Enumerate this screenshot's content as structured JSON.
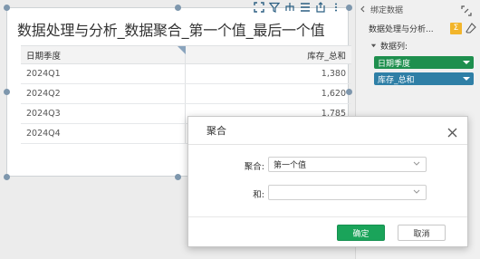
{
  "widget": {
    "title": "数据处理与分析_数据聚合_第一个值_最后一个值",
    "toolbar_icons": [
      "expand-icon",
      "filter-icon",
      "hierarchy-icon",
      "list-icon",
      "export-icon",
      "more-icon"
    ]
  },
  "table": {
    "columns": [
      "日期季度",
      "库存_总和"
    ],
    "rows": [
      [
        "2024Q1",
        "1,380"
      ],
      [
        "2024Q2",
        "1,620"
      ],
      [
        "2024Q3",
        "1,785"
      ],
      [
        "2024Q4",
        ""
      ]
    ]
  },
  "panel": {
    "header": "绑定数据",
    "dataset": "数据处理与分析...",
    "sigma": "Σ",
    "columns_label": "数据列:",
    "fields": [
      {
        "label": "日期季度",
        "color": "#1e8f4e"
      },
      {
        "label": "库存_总和",
        "color": "#2f7fa6"
      }
    ]
  },
  "dialog": {
    "title": "聚合",
    "agg_label": "聚合:",
    "agg_value": "第一个值",
    "sum_label": "和:",
    "sum_value": "",
    "ok_label": "确定",
    "cancel_label": "取消"
  },
  "colors": {
    "ok": "#1aa45a",
    "accent": "#8aa4bd"
  }
}
